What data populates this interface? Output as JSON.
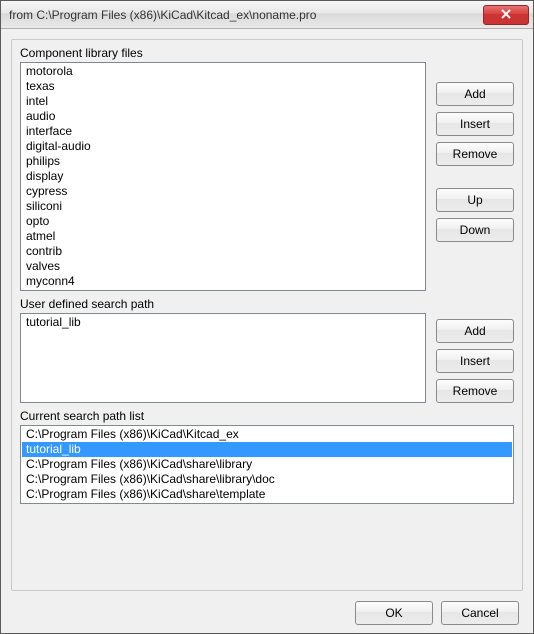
{
  "window": {
    "title": "from C:\\Program Files (x86)\\KiCad\\Kitcad_ex\\noname.pro"
  },
  "labels": {
    "component_library": "Component library files",
    "user_search_path": "User defined search path",
    "current_search_path": "Current search path list"
  },
  "buttons": {
    "add": "Add",
    "insert": "Insert",
    "remove": "Remove",
    "up": "Up",
    "down": "Down",
    "ok": "OK",
    "cancel": "Cancel"
  },
  "component_libraries": [
    "motorola",
    "texas",
    "intel",
    "audio",
    "interface",
    "digital-audio",
    "philips",
    "display",
    "cypress",
    "siliconi",
    "opto",
    "atmel",
    "contrib",
    "valves",
    "myconn4"
  ],
  "user_paths": [
    "tutorial_lib"
  ],
  "current_paths": [
    {
      "text": "C:\\Program Files (x86)\\KiCad\\Kitcad_ex",
      "selected": false
    },
    {
      "text": "tutorial_lib",
      "selected": true
    },
    {
      "text": "C:\\Program Files (x86)\\KiCad\\share\\library",
      "selected": false
    },
    {
      "text": "C:\\Program Files (x86)\\KiCad\\share\\library\\doc",
      "selected": false
    },
    {
      "text": "C:\\Program Files (x86)\\KiCad\\share\\template",
      "selected": false
    }
  ]
}
